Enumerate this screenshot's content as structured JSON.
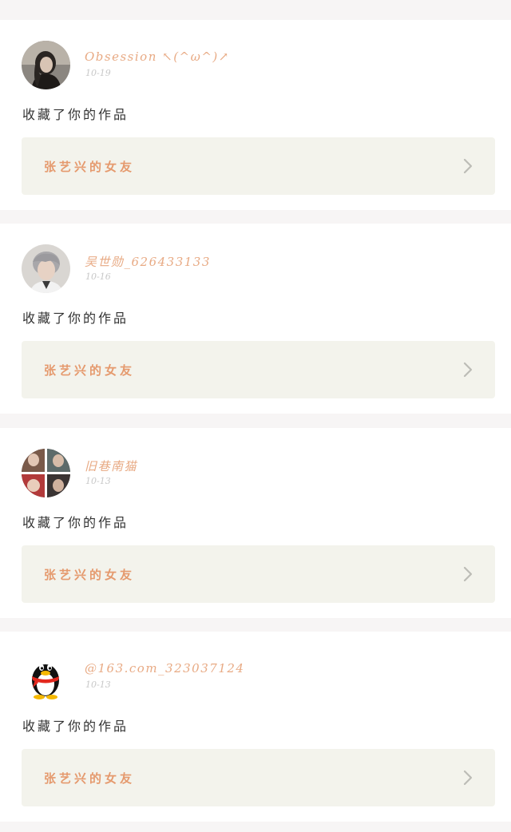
{
  "notifications": [
    {
      "username": "Obsession ↖(^ω^)↗",
      "date": "10-19",
      "action": "收藏了你的作品",
      "work_title": "张艺兴的女友",
      "avatar_icon": "user-photo-dark-hair"
    },
    {
      "username": "吴世勋_626433133",
      "date": "10-16",
      "action": "收藏了你的作品",
      "work_title": "张艺兴的女友",
      "avatar_icon": "user-photo-silver-hair"
    },
    {
      "username": "旧巷南猫",
      "date": "10-13",
      "action": "收藏了你的作品",
      "work_title": "张艺兴的女友",
      "avatar_icon": "user-photo-collage"
    },
    {
      "username": "@163.com_323037124",
      "date": "10-13",
      "action": "收藏了你的作品",
      "work_title": "张艺兴的女友",
      "avatar_icon": "qq-penguin-icon"
    }
  ],
  "colors": {
    "username": "#e8aa84",
    "work_title": "#e59a6e",
    "work_card_bg": "#f3f3ec",
    "date": "#c8c8c8",
    "separator": "#f7f5f5"
  }
}
